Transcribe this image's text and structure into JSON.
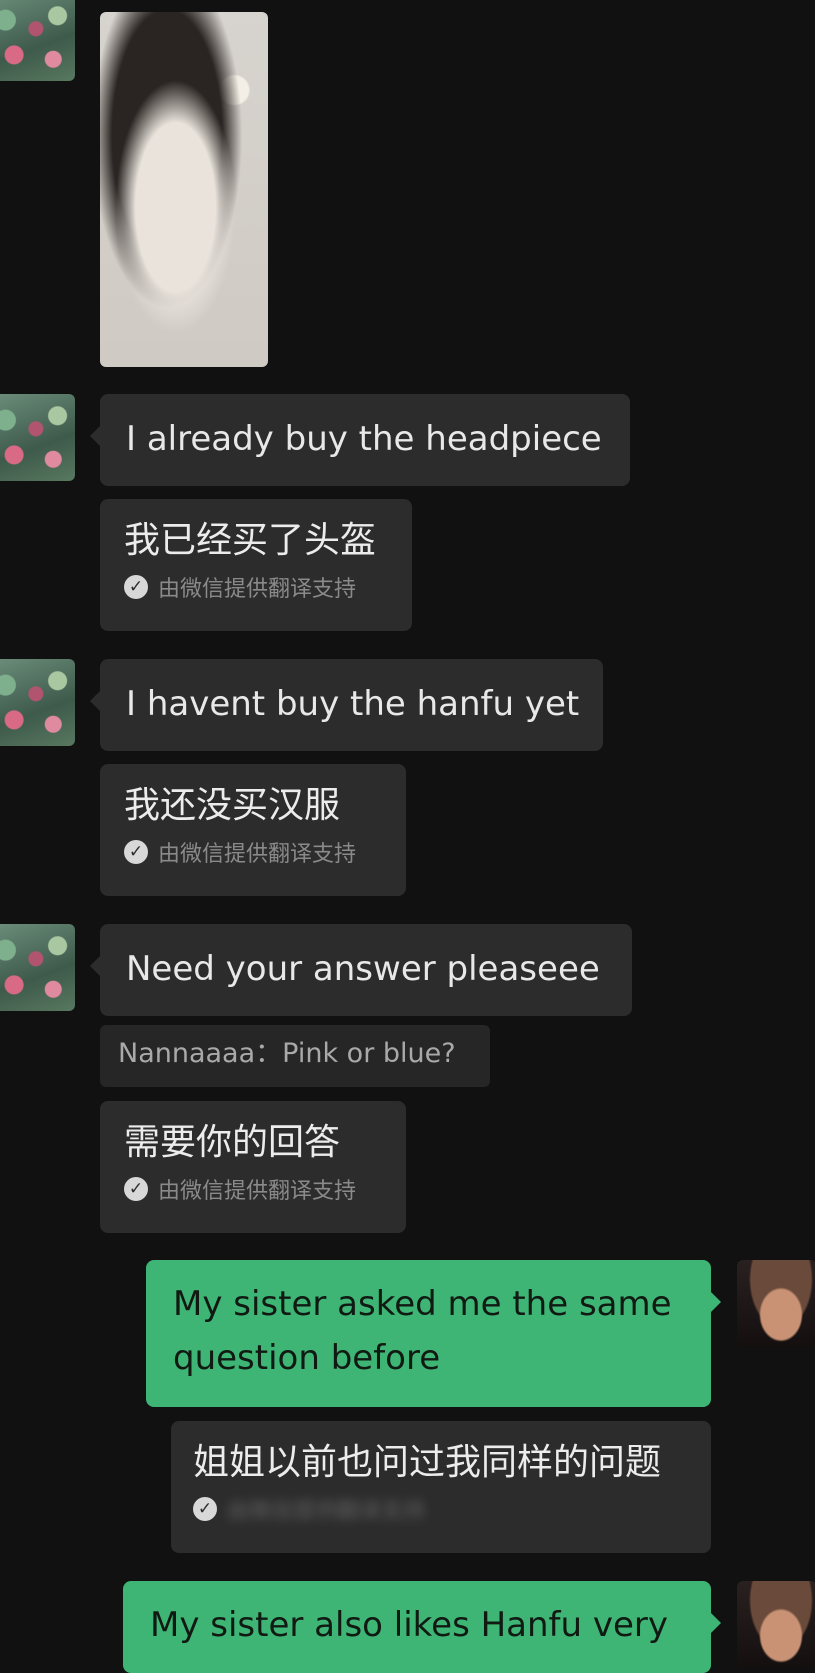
{
  "messages": {
    "m1": {
      "text": "I already buy the headpiece",
      "translation": "我已经买了头盔"
    },
    "m2": {
      "text": "I havent buy the hanfu yet",
      "translation": "我还没买汉服"
    },
    "m3": {
      "text": "Need your answer pleaseee",
      "translation": "需要你的回答",
      "quote": "Nannaaaa：Pink or blue?"
    },
    "m4": {
      "text_line1": "My sister asked me the same",
      "text_line2": "question before",
      "translation": "姐姐以前也问过我同样的问题"
    },
    "m5": {
      "text": "My sister also likes Hanfu very"
    }
  },
  "translation_credit": "由微信提供翻译支持",
  "icons": {
    "check": "check-circle-icon"
  },
  "colors": {
    "background": "#111111",
    "bubble_gray": "#2c2c2c",
    "bubble_green": "#3eb575"
  }
}
